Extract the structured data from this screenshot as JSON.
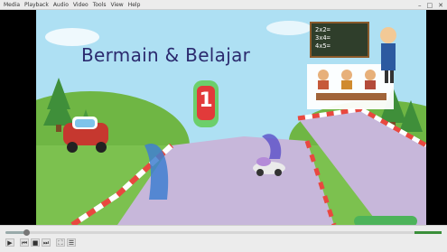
{
  "window": {
    "menu": [
      "Media",
      "Playback",
      "Audio",
      "Video",
      "Tools",
      "View",
      "Help"
    ],
    "controls": [
      "–",
      "□",
      "✕"
    ]
  },
  "video": {
    "title": "Bermain & Belajar",
    "chalkboard": [
      "2x2=",
      "3x4=",
      "4x5="
    ],
    "sign_number": "1",
    "colors": {
      "sky": "#aee0f3",
      "grass": "#7cc14f",
      "road": "#c7b7da",
      "title": "#2b2a6e"
    }
  },
  "player": {
    "progress": 0.05,
    "buttons": [
      "play-icon",
      "prev-icon",
      "stop-icon",
      "next-icon",
      "fullscreen-icon",
      "playlist-icon"
    ],
    "button_glyphs": [
      "▶",
      "⏮",
      "■",
      "⏭",
      "⛶",
      "☰"
    ]
  }
}
